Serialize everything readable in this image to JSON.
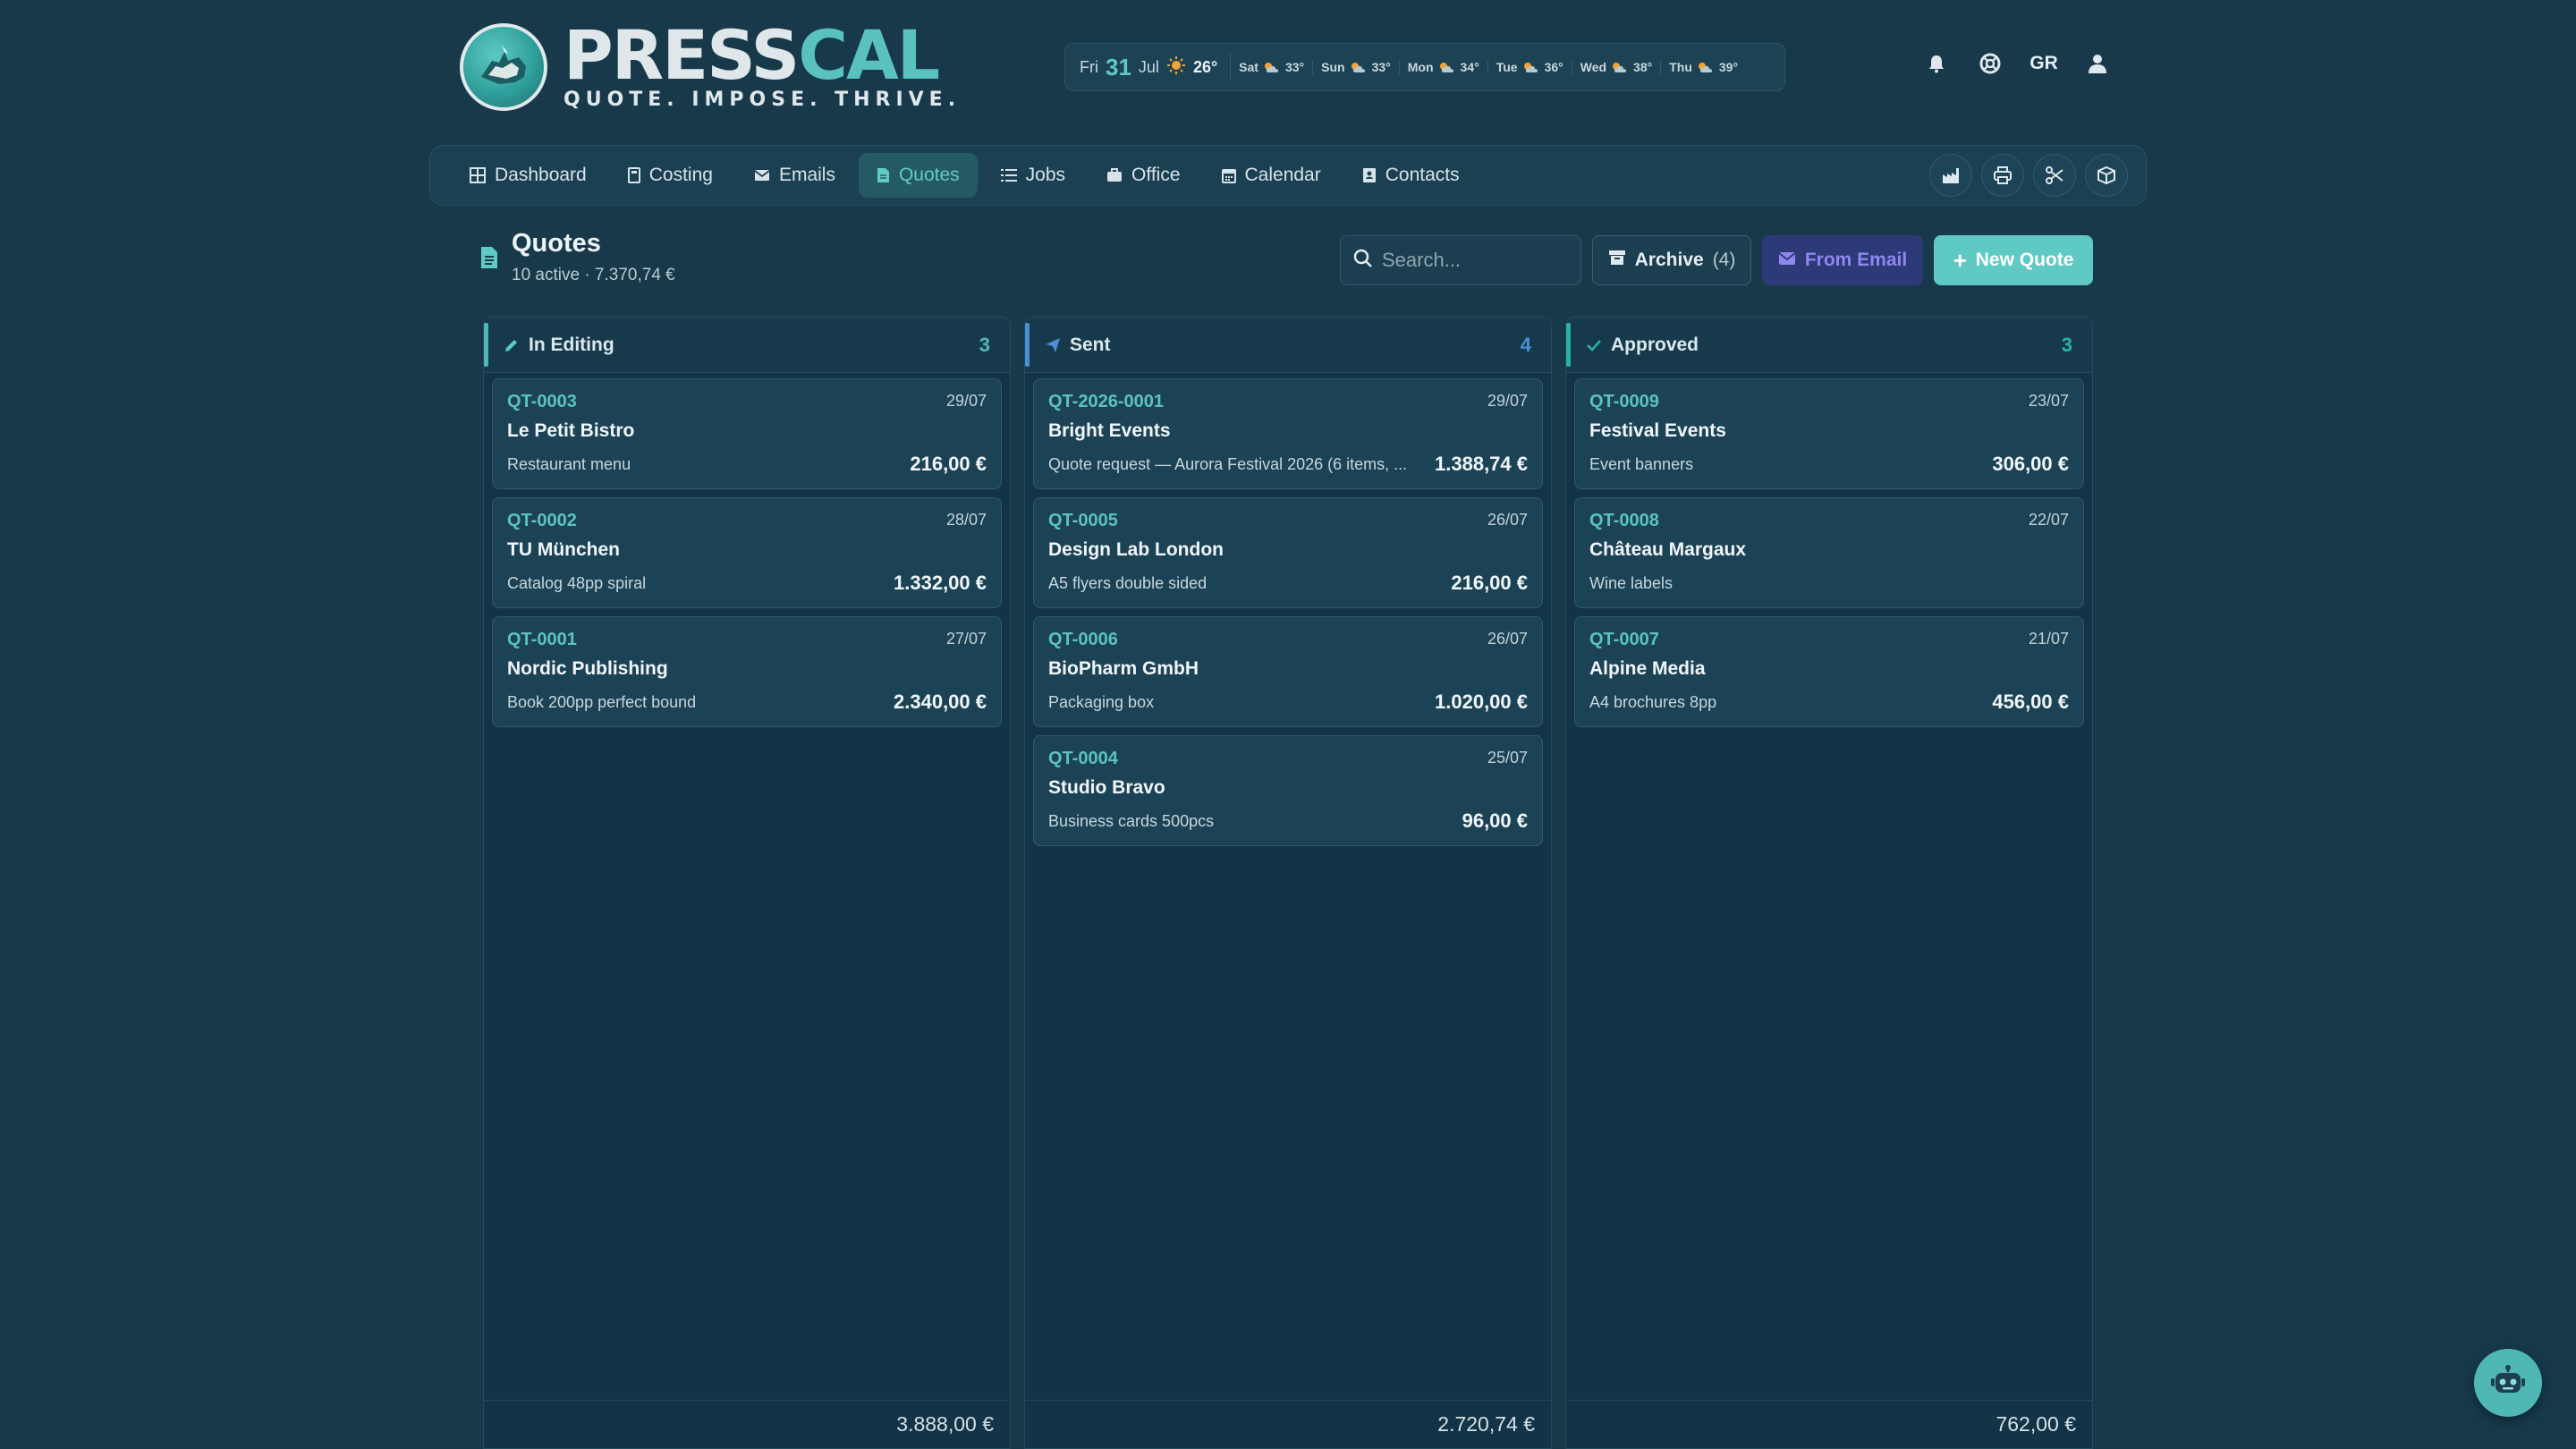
{
  "brand": {
    "name_part1": "PRESS",
    "name_part2": "CAL",
    "tagline": "QUOTE. IMPOSE. THRIVE."
  },
  "weather": {
    "today": {
      "day": "Fri",
      "date": "31",
      "month": "Jul",
      "icon": "sun-icon",
      "temp": "26°"
    },
    "forecast": [
      {
        "day": "Sat",
        "icon": "cloud-sun-icon",
        "temp": "33°"
      },
      {
        "day": "Sun",
        "icon": "cloud-sun-icon",
        "temp": "33°"
      },
      {
        "day": "Mon",
        "icon": "cloud-sun-icon",
        "temp": "34°"
      },
      {
        "day": "Tue",
        "icon": "cloud-sun-icon",
        "temp": "36°"
      },
      {
        "day": "Wed",
        "icon": "cloud-sun-icon",
        "temp": "38°"
      },
      {
        "day": "Thu",
        "icon": "cloud-sun-icon",
        "temp": "39°"
      }
    ]
  },
  "header": {
    "language": "GR"
  },
  "nav": {
    "items": [
      {
        "label": "Dashboard",
        "icon": "grid-icon"
      },
      {
        "label": "Costing",
        "icon": "calculator-icon"
      },
      {
        "label": "Emails",
        "icon": "envelope-icon"
      },
      {
        "label": "Quotes",
        "icon": "document-icon",
        "active": true
      },
      {
        "label": "Jobs",
        "icon": "list-icon"
      },
      {
        "label": "Office",
        "icon": "briefcase-icon"
      },
      {
        "label": "Calendar",
        "icon": "calendar-icon"
      },
      {
        "label": "Contacts",
        "icon": "contact-book-icon"
      }
    ],
    "tools": [
      "factory-icon",
      "printer-icon",
      "scissors-icon",
      "box-icon"
    ]
  },
  "page": {
    "title": "Quotes",
    "subtitle": "10 active · 7.370,74 €"
  },
  "toolbar": {
    "search_placeholder": "Search...",
    "archive_label": "Archive",
    "archive_count": "(4)",
    "from_email_label": "From Email",
    "new_quote_label": "New Quote"
  },
  "columns": [
    {
      "title": "In Editing",
      "count": "3",
      "accent": "#4fb8b4",
      "icon": "pencil-icon",
      "total": "3.888,00 €",
      "cards": [
        {
          "id": "QT-0003",
          "date": "29/07",
          "client": "Le Petit Bistro",
          "desc": "Restaurant menu",
          "amount": "216,00 €"
        },
        {
          "id": "QT-0002",
          "date": "28/07",
          "client": "TU München",
          "desc": "Catalog 48pp spiral",
          "amount": "1.332,00 €"
        },
        {
          "id": "QT-0001",
          "date": "27/07",
          "client": "Nordic Publishing",
          "desc": "Book 200pp perfect bound",
          "amount": "2.340,00 €"
        }
      ]
    },
    {
      "title": "Sent",
      "count": "4",
      "accent": "#4a8fd6",
      "icon": "paper-plane-icon",
      "total": "2.720,74 €",
      "cards": [
        {
          "id": "QT-2026-0001",
          "date": "29/07",
          "client": "Bright Events",
          "desc": "Quote request — Aurora Festival 2026 (6 items, ...",
          "amount": "1.388,74 €"
        },
        {
          "id": "QT-0005",
          "date": "26/07",
          "client": "Design Lab London",
          "desc": "A5 flyers double sided",
          "amount": "216,00 €"
        },
        {
          "id": "QT-0006",
          "date": "26/07",
          "client": "BioPharm GmbH",
          "desc": "Packaging box",
          "amount": "1.020,00 €"
        },
        {
          "id": "QT-0004",
          "date": "25/07",
          "client": "Studio Bravo",
          "desc": "Business cards 500pcs",
          "amount": "96,00 €"
        }
      ]
    },
    {
      "title": "Approved",
      "count": "3",
      "accent": "#2bb3a2",
      "icon": "check-icon",
      "total": "762,00 €",
      "cards": [
        {
          "id": "QT-0009",
          "date": "23/07",
          "client": "Festival Events",
          "desc": "Event banners",
          "amount": "306,00 €"
        },
        {
          "id": "QT-0008",
          "date": "22/07",
          "client": "Château Margaux",
          "desc": "Wine labels",
          "amount": ""
        },
        {
          "id": "QT-0007",
          "date": "21/07",
          "client": "Alpine Media",
          "desc": "A4 brochures 8pp",
          "amount": "456,00 €"
        }
      ]
    }
  ],
  "assistant": {
    "icon": "robot-icon"
  }
}
